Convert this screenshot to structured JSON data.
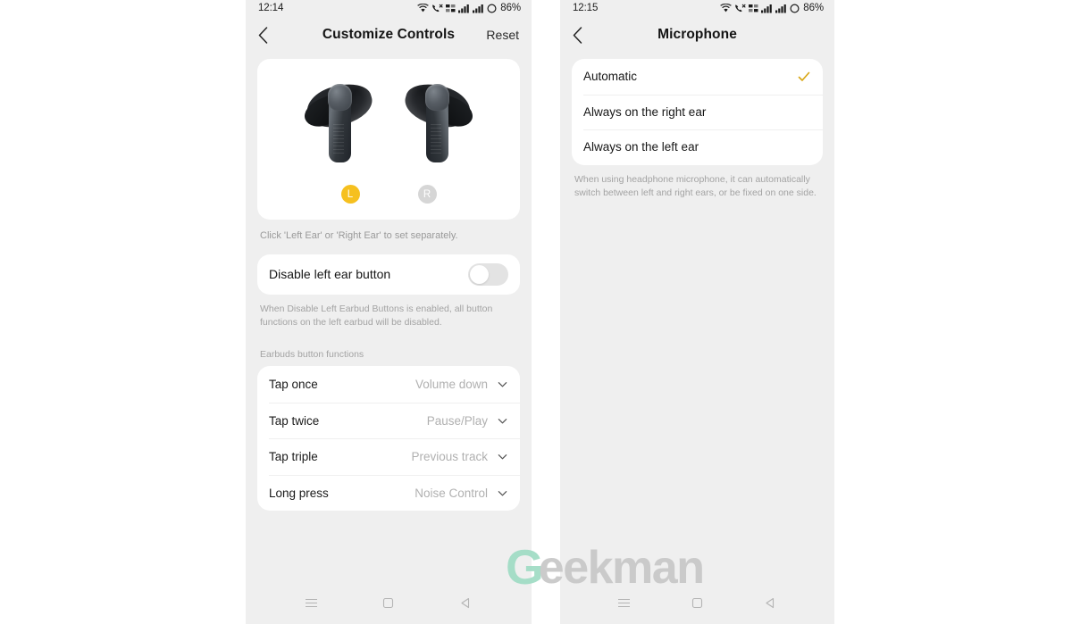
{
  "left_phone": {
    "status_bar": {
      "time": "12:14",
      "battery": "86%",
      "icons": [
        "wifi-icon",
        "call-signal-icon",
        "mobile-data-icon",
        "signal-bars-icon",
        "signal-bars-2-icon",
        "battery-icon"
      ]
    },
    "header": {
      "back_icon": "chevron-left-icon",
      "title": "Customize Controls",
      "action_label": "Reset"
    },
    "earbuds_card": {
      "left_badge": "L",
      "right_badge": "R",
      "hint": "Click 'Left Ear' or 'Right Ear' to set separately."
    },
    "disable_toggle": {
      "label": "Disable left ear button",
      "state": "off",
      "description": "When Disable Left Earbud Buttons is enabled, all button functions on the left earbud will be disabled."
    },
    "functions_section": {
      "label": "Earbuds button functions",
      "rows": [
        {
          "key": "Tap once",
          "value": "Volume down"
        },
        {
          "key": "Tap twice",
          "value": "Pause/Play"
        },
        {
          "key": "Tap triple",
          "value": "Previous track"
        },
        {
          "key": "Long press",
          "value": "Noise Control"
        }
      ]
    },
    "android_nav": [
      "menu-icon",
      "home-square-icon",
      "back-triangle-icon"
    ]
  },
  "right_phone": {
    "status_bar": {
      "time": "12:15",
      "battery": "86%"
    },
    "header": {
      "back_icon": "chevron-left-icon",
      "title": "Microphone"
    },
    "options": [
      {
        "label": "Automatic",
        "selected": true
      },
      {
        "label": "Always on the right ear",
        "selected": false
      },
      {
        "label": "Always on the left ear",
        "selected": false
      }
    ],
    "description": "When using headphone microphone, it can automatically switch between left and right ears, or be fixed on one side.",
    "android_nav": [
      "menu-icon",
      "home-square-icon",
      "back-triangle-icon"
    ]
  },
  "watermark": {
    "first_letter": "G",
    "rest": "eekman"
  },
  "colors": {
    "accent_yellow": "#f6c01f",
    "check_gold": "#d9a818",
    "panel_bg": "#efefef",
    "card_bg": "#ffffff",
    "muted_text": "#a3a3a3",
    "watermark_green": "#9fdcc4",
    "watermark_gray": "#c9c9c9"
  }
}
